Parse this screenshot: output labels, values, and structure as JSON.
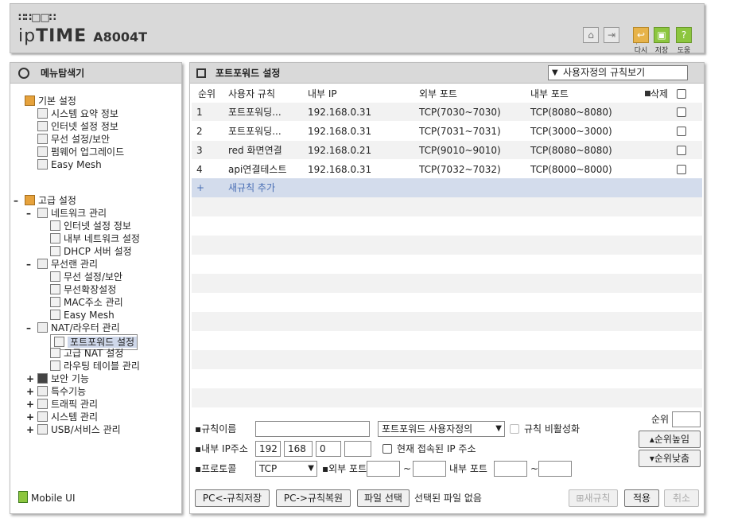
{
  "header": {
    "logo_dots": "∷∷□□∷",
    "logo_prefix": "ip",
    "logo_brand": "TIME",
    "model": "A8004T",
    "buttons": [
      {
        "icon": "home-icon"
      },
      {
        "icon": "logout-icon"
      },
      {
        "icon": "back-icon",
        "label": "다시"
      },
      {
        "icon": "save-icon",
        "label": "저장"
      },
      {
        "icon": "help-icon",
        "label": "도움"
      }
    ]
  },
  "sidebar": {
    "title": "메뉴탐색기",
    "basic": {
      "label": "기본 설정",
      "items": [
        "시스템 요약 정보",
        "인터넷 설정 정보",
        "무선 설정/보안",
        "펌웨어 업그레이드",
        "Easy Mesh"
      ]
    },
    "advanced": {
      "label": "고급 설정",
      "network": {
        "label": "네트워크 관리",
        "items": [
          "인터넷 설정 정보",
          "내부 네트워크 설정",
          "DHCP 서버 설정"
        ]
      },
      "wireless": {
        "label": "무선랜 관리",
        "items": [
          "무선 설정/보안",
          "무선확장설정",
          "MAC주소 관리",
          "Easy Mesh"
        ]
      },
      "nat": {
        "label": "NAT/라우터 관리",
        "items": [
          "포트포워드 설정",
          "고급 NAT 설정",
          "라우팅 테이블 관리"
        ]
      },
      "others": [
        "보안 기능",
        "특수기능",
        "트래픽 관리",
        "시스템 관리",
        "USB/서비스 관리"
      ]
    },
    "mobile_label": "Mobile UI"
  },
  "main": {
    "title": "포트포워드 설정",
    "view_select": "사용자정의 규칙보기",
    "columns": [
      "순위",
      "사용자 규칙",
      "내부 IP",
      "외부 포트",
      "내부 포트",
      "삭제"
    ],
    "rows": [
      {
        "rank": "1",
        "name": "포트포워딩...",
        "ip": "192.168.0.31",
        "ext": "TCP(7030~7030)",
        "int": "TCP(8080~8080)"
      },
      {
        "rank": "2",
        "name": "포트포워딩...",
        "ip": "192.168.0.31",
        "ext": "TCP(7031~7031)",
        "int": "TCP(3000~3000)"
      },
      {
        "rank": "3",
        "name": "red 화면연결",
        "ip": "192.168.0.21",
        "ext": "TCP(9010~9010)",
        "int": "TCP(8080~8080)"
      },
      {
        "rank": "4",
        "name": "api연결테스트",
        "ip": "192.168.0.31",
        "ext": "TCP(7032~7032)",
        "int": "TCP(8000~8000)"
      }
    ],
    "add_rule": "새규칙 추가",
    "add_symbol": "+"
  },
  "form": {
    "rule_name_label": "규칙이름",
    "rule_name_value": "",
    "rule_type": "포트포워드 사용자정의",
    "disable_label": "규칙 비활성화",
    "ip_label": "내부 IP주소",
    "ip1": "192",
    "ip2": "168",
    "ip3": "0",
    "ip4": "",
    "current_ip_label": "현재 접속된 IP 주소",
    "protocol_label": "프로토콜",
    "protocol": "TCP",
    "ext_port_label": "외부 포트",
    "int_port_label": "내부 포트",
    "tilde": "~",
    "rank_label": "순위",
    "rank_up": "순위높임",
    "rank_down": "순위낮춤",
    "pc_save": "PC<-규칙저장",
    "pc_restore": "PC->규칙복원",
    "file_select": "파일 선택",
    "file_status": "선택된 파일 없음",
    "new_rule": "새규칙",
    "apply": "적용",
    "cancel": "취소"
  }
}
